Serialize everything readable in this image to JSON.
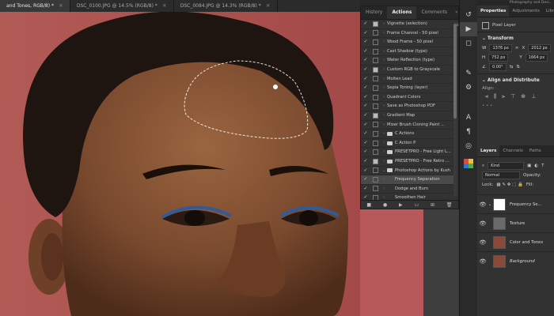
{
  "doc_tabs": [
    {
      "label": "and Tones, RGB/8) *",
      "active": true
    },
    {
      "label": "DSC_0100.JPG @ 14.5% (RGB/8) *",
      "active": false
    },
    {
      "label": "DSC_0084.JPG @ 14.3% (RGB/8) *",
      "active": false
    }
  ],
  "actions_panel": {
    "tabs": [
      "History",
      "Actions",
      "Comments"
    ],
    "active_tab": "Actions",
    "items": [
      {
        "label": "Vignette (selection)",
        "checked": true,
        "type": "action"
      },
      {
        "label": "Frame Channel - 50 pixel",
        "checked": true,
        "type": "action"
      },
      {
        "label": "Wood Frame - 50 pixel",
        "checked": true,
        "type": "action"
      },
      {
        "label": "Cast Shadow (type)",
        "checked": true,
        "type": "action"
      },
      {
        "label": "Water Reflection (type)",
        "checked": true,
        "type": "action"
      },
      {
        "label": "Custom RGB to Grayscale",
        "checked": true,
        "type": "action"
      },
      {
        "label": "Molten Lead",
        "checked": true,
        "type": "action"
      },
      {
        "label": "Sepia Toning (layer)",
        "checked": true,
        "type": "action"
      },
      {
        "label": "Quadrant Colors",
        "checked": true,
        "type": "action"
      },
      {
        "label": "Save as Photoshop PDF",
        "checked": true,
        "type": "action"
      },
      {
        "label": "Gradient Map",
        "checked": true,
        "type": "action"
      },
      {
        "label": "Mixer Brush Cloning Paint ...",
        "checked": true,
        "type": "action"
      },
      {
        "label": "C Actions",
        "checked": true,
        "type": "set"
      },
      {
        "label": "C Action P",
        "checked": true,
        "type": "set"
      },
      {
        "label": "PRESETPRO - Free Light L...",
        "checked": true,
        "type": "set"
      },
      {
        "label": "PRESETPRO - Free Retro ...",
        "checked": true,
        "type": "set"
      },
      {
        "label": "Photoshop Actions by Kush",
        "checked": true,
        "type": "set-open"
      },
      {
        "label": "Frequency Separation",
        "checked": true,
        "type": "action-sel"
      },
      {
        "label": "Dodge and Burn",
        "checked": true,
        "type": "action"
      },
      {
        "label": "Smoothen Hair",
        "checked": true,
        "type": "action"
      },
      {
        "label": "Sharpening",
        "checked": true,
        "type": "action"
      }
    ],
    "bottom_icons": [
      "stop-icon",
      "record-icon",
      "play-icon",
      "new-set-icon",
      "new-action-icon",
      "delete-icon"
    ]
  },
  "properties": {
    "top_label": "Photography and Desi...",
    "tabs": [
      "Properties",
      "Adjustments",
      "Librari"
    ],
    "pixel_layer_label": "Pixel Layer",
    "transform_label": "Transform",
    "w_label": "W",
    "w_value": "1376 px",
    "x_label": "X",
    "x_value": "2012 px",
    "h_label": "H",
    "h_value": "752 px",
    "y_label": "Y",
    "y_value": "1664 px",
    "angle_value": "0.00°",
    "align_label": "Align and Distribute",
    "align_sub": "Align:"
  },
  "layers_panel": {
    "tabs": [
      "Layers",
      "Channels",
      "Paths"
    ],
    "kind_label": "Kind",
    "blend_mode": "Normal",
    "opacity_label": "Opacity:",
    "lock_label": "Lock:",
    "fill_label": "Fill:",
    "layers": [
      {
        "name": "Frequency Se...",
        "thumb": "white"
      },
      {
        "name": "Texture",
        "thumb": "gray"
      },
      {
        "name": "Color and Tones",
        "thumb": "face"
      },
      {
        "name": "Background",
        "thumb": "face"
      }
    ]
  },
  "colors": {
    "backdrop": "#b25a55",
    "skin": "#7a4a2e",
    "hair": "#1e1410",
    "panel": "#323232"
  }
}
